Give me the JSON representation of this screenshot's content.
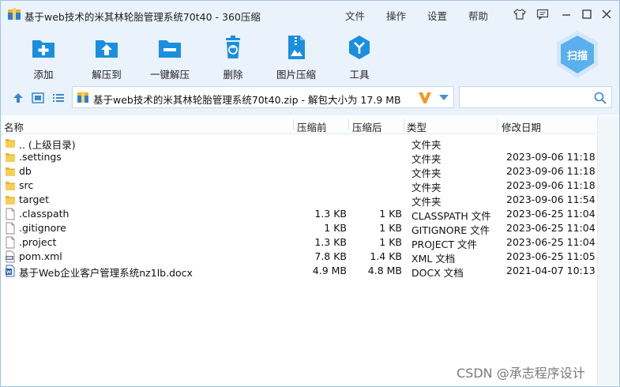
{
  "window": {
    "title": "基于web技术的米其林轮胎管理系统70t40 - 360压缩",
    "menu": [
      "文件",
      "操作",
      "设置",
      "帮助"
    ]
  },
  "toolbar": {
    "items": [
      {
        "label": "添加",
        "icon": "add-icon"
      },
      {
        "label": "解压到",
        "icon": "extract-to-icon"
      },
      {
        "label": "一键解压",
        "icon": "one-click-extract-icon"
      },
      {
        "label": "删除",
        "icon": "delete-icon"
      },
      {
        "label": "图片压缩",
        "icon": "image-compress-icon"
      },
      {
        "label": "工具",
        "icon": "tools-icon"
      }
    ],
    "scan_label": "扫描"
  },
  "address": {
    "path": "基于web技术的米其林轮胎管理系统70t40.zip - 解包大小为 17.9 MB",
    "search_placeholder": ""
  },
  "columns": {
    "name": "名称",
    "packed": "压缩前",
    "compressed": "压缩后",
    "type": "类型",
    "modified": "修改日期"
  },
  "files": [
    {
      "name": ".. (上级目录)",
      "packed": "",
      "compressed": "",
      "type": "文件夹",
      "modified": "",
      "icon": "folder"
    },
    {
      "name": ".settings",
      "packed": "",
      "compressed": "",
      "type": "文件夹",
      "modified": "2023-09-06 11:18",
      "icon": "folder"
    },
    {
      "name": "db",
      "packed": "",
      "compressed": "",
      "type": "文件夹",
      "modified": "2023-09-06 11:18",
      "icon": "folder"
    },
    {
      "name": "src",
      "packed": "",
      "compressed": "",
      "type": "文件夹",
      "modified": "2023-09-06 11:18",
      "icon": "folder"
    },
    {
      "name": "target",
      "packed": "",
      "compressed": "",
      "type": "文件夹",
      "modified": "2023-09-06 11:54",
      "icon": "folder"
    },
    {
      "name": ".classpath",
      "packed": "1.3 KB",
      "compressed": "1 KB",
      "type": "CLASSPATH 文件",
      "modified": "2023-06-25 11:04",
      "icon": "file"
    },
    {
      "name": ".gitignore",
      "packed": "1 KB",
      "compressed": "1 KB",
      "type": "GITIGNORE 文件",
      "modified": "2023-06-25 11:04",
      "icon": "file"
    },
    {
      "name": ".project",
      "packed": "1.3 KB",
      "compressed": "1 KB",
      "type": "PROJECT 文件",
      "modified": "2023-06-25 11:04",
      "icon": "file"
    },
    {
      "name": "pom.xml",
      "packed": "7.8 KB",
      "compressed": "1.4 KB",
      "type": "XML 文档",
      "modified": "2023-06-25 11:05",
      "icon": "xml"
    },
    {
      "name": "基于Web企业客户管理系统nz1lb.docx",
      "packed": "4.9 MB",
      "compressed": "4.8 MB",
      "type": "DOCX 文档",
      "modified": "2021-04-07 10:13",
      "icon": "docx"
    }
  ],
  "watermark": "CSDN @承志程序设计",
  "colors": {
    "accent": "#1a8fe0",
    "band": "#eaf3fc",
    "folder": "#e9b52c"
  }
}
